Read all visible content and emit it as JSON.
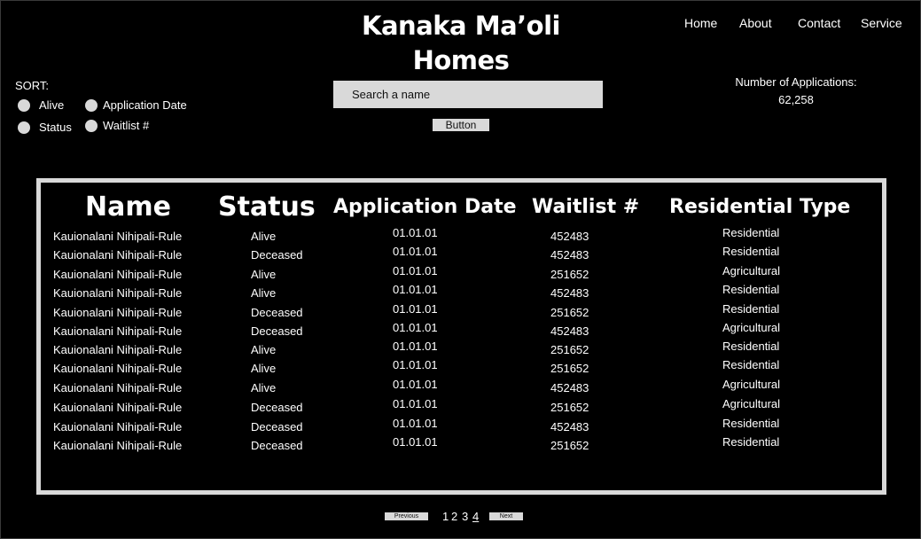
{
  "header": {
    "title_line1": "Kanaka Ma’oli",
    "title_line2": "Homes",
    "nav": [
      "Home",
      "About",
      "Contact",
      "Service"
    ]
  },
  "sort": {
    "label": "SORT:",
    "options": [
      "Alive",
      "Status",
      "Application Date",
      "Waitlist #"
    ]
  },
  "search": {
    "placeholder": "Search a name",
    "value": ""
  },
  "button_label": "Button",
  "applications": {
    "label": "Number of Applications:",
    "count": "62,258"
  },
  "table": {
    "columns": [
      "Name",
      "Status",
      "Application Date",
      "Waitlist #",
      "Residential Type"
    ],
    "rows": [
      [
        "Kauionalani Nihipali-Rule",
        "Alive",
        "01.01.01",
        "452483",
        "Residential"
      ],
      [
        "Kauionalani Nihipali-Rule",
        "Deceased",
        "01.01.01",
        "452483",
        "Residential"
      ],
      [
        "Kauionalani Nihipali-Rule",
        "Alive",
        "01.01.01",
        "251652",
        "Agricultural"
      ],
      [
        "Kauionalani Nihipali-Rule",
        "Alive",
        "01.01.01",
        "452483",
        "Residential"
      ],
      [
        "Kauionalani Nihipali-Rule",
        "Deceased",
        "01.01.01",
        "251652",
        "Residential"
      ],
      [
        "Kauionalani Nihipali-Rule",
        "Deceased",
        "01.01.01",
        "452483",
        "Agricultural"
      ],
      [
        "Kauionalani Nihipali-Rule",
        "Alive",
        "01.01.01",
        "251652",
        "Residential"
      ],
      [
        "Kauionalani Nihipali-Rule",
        "Alive",
        "01.01.01",
        "251652",
        "Residential"
      ],
      [
        "Kauionalani Nihipali-Rule",
        "Alive",
        "01.01.01",
        "452483",
        "Agricultural"
      ],
      [
        "Kauionalani Nihipali-Rule",
        "Deceased",
        "01.01.01",
        "251652",
        "Agricultural"
      ],
      [
        "Kauionalani Nihipali-Rule",
        "Deceased",
        "01.01.01",
        "452483",
        "Residential"
      ],
      [
        "Kauionalani Nihipali-Rule",
        "Deceased",
        "01.01.01",
        "251652",
        "Residential"
      ]
    ]
  },
  "pagination": {
    "previous": "Previous",
    "pages": [
      "1",
      "2",
      "3",
      "4"
    ],
    "current": "4",
    "next": "Next"
  }
}
